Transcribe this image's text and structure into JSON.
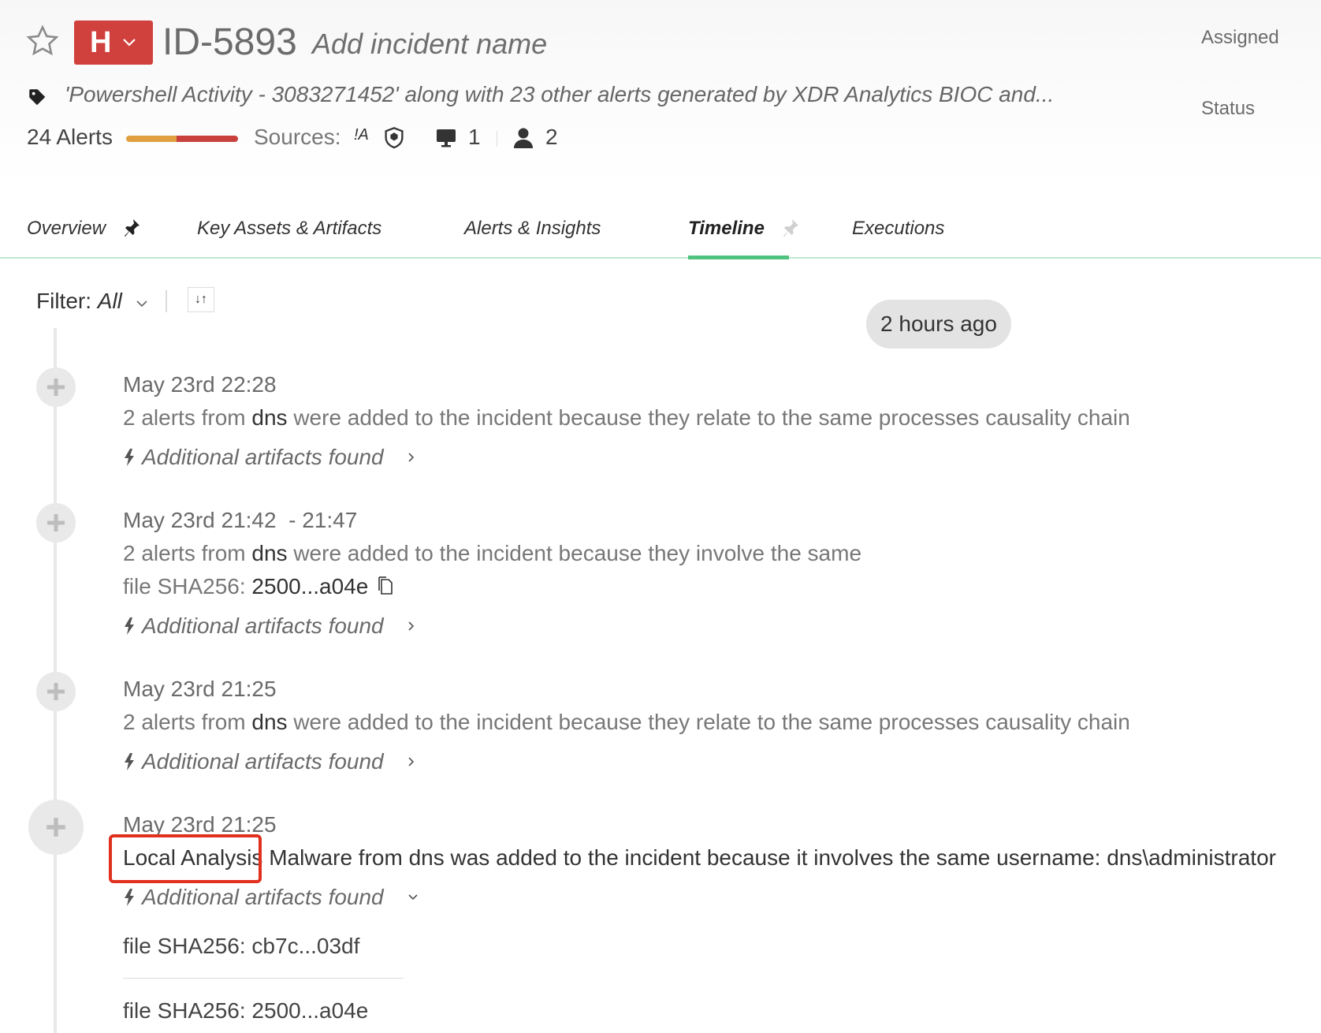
{
  "incident": {
    "severity_letter": "H",
    "id": "ID-5893",
    "name_placeholder": "Add incident name",
    "description": "'Powershell Activity - 3083271452' along with 23 other alerts generated by XDR Analytics BIOC and...",
    "alerts_count": "24 Alerts",
    "severity_split": {
      "medium": 0.45,
      "high": 0.55
    },
    "sources_label": "Sources:",
    "source_a_glyph": "!A",
    "host_count": "1",
    "user_count": "2"
  },
  "side_panel": {
    "assigned_label": "Assigned",
    "status_label": "Status"
  },
  "tabs": [
    {
      "label": "Overview",
      "pinned": true
    },
    {
      "label": "Key Assets & Artifacts"
    },
    {
      "label": "Alerts & Insights"
    },
    {
      "label": "Timeline",
      "active": true,
      "pinned": false
    },
    {
      "label": "Executions"
    }
  ],
  "filter": {
    "label": "Filter:",
    "value": "All",
    "sort_glyph": "↓↑"
  },
  "time_pill": "2 hours ago",
  "timeline": [
    {
      "date": "May 23rd 22:28",
      "text_pre": "2 alerts from ",
      "source": "dns",
      "text_post": " were added to the incident because they relate to the same processes causality chain",
      "artifacts_label": "Additional artifacts found"
    },
    {
      "date": "May 23rd 21:42  - 21:47",
      "text_pre": "2 alerts from ",
      "source": "dns",
      "text_post": " were added to the incident because they involve the same",
      "sha_label": "file SHA256: ",
      "sha_value": "2500...a04e",
      "artifacts_label": "Additional artifacts found"
    },
    {
      "date": "May 23rd 21:25",
      "text_pre": "2 alerts from ",
      "source": "dns",
      "text_post": " were added to the incident because they relate to the same processes causality chain",
      "artifacts_label": "Additional artifacts found"
    },
    {
      "date": "May 23rd 21:25",
      "highlight": "Local Analysis",
      "text_post": " Malware from dns was added to the incident because it involves the same username: dns\\administrator",
      "artifacts_label": "Additional artifacts found",
      "artifacts": [
        "file SHA256: cb7c...03df",
        "file SHA256: 2500...a04e"
      ]
    }
  ],
  "colors": {
    "severity_high": "#d0413d",
    "severity_bar_medium": "#e0a040",
    "active_tab_underline": "#4fc27e",
    "highlight_box": "#e0301e"
  }
}
